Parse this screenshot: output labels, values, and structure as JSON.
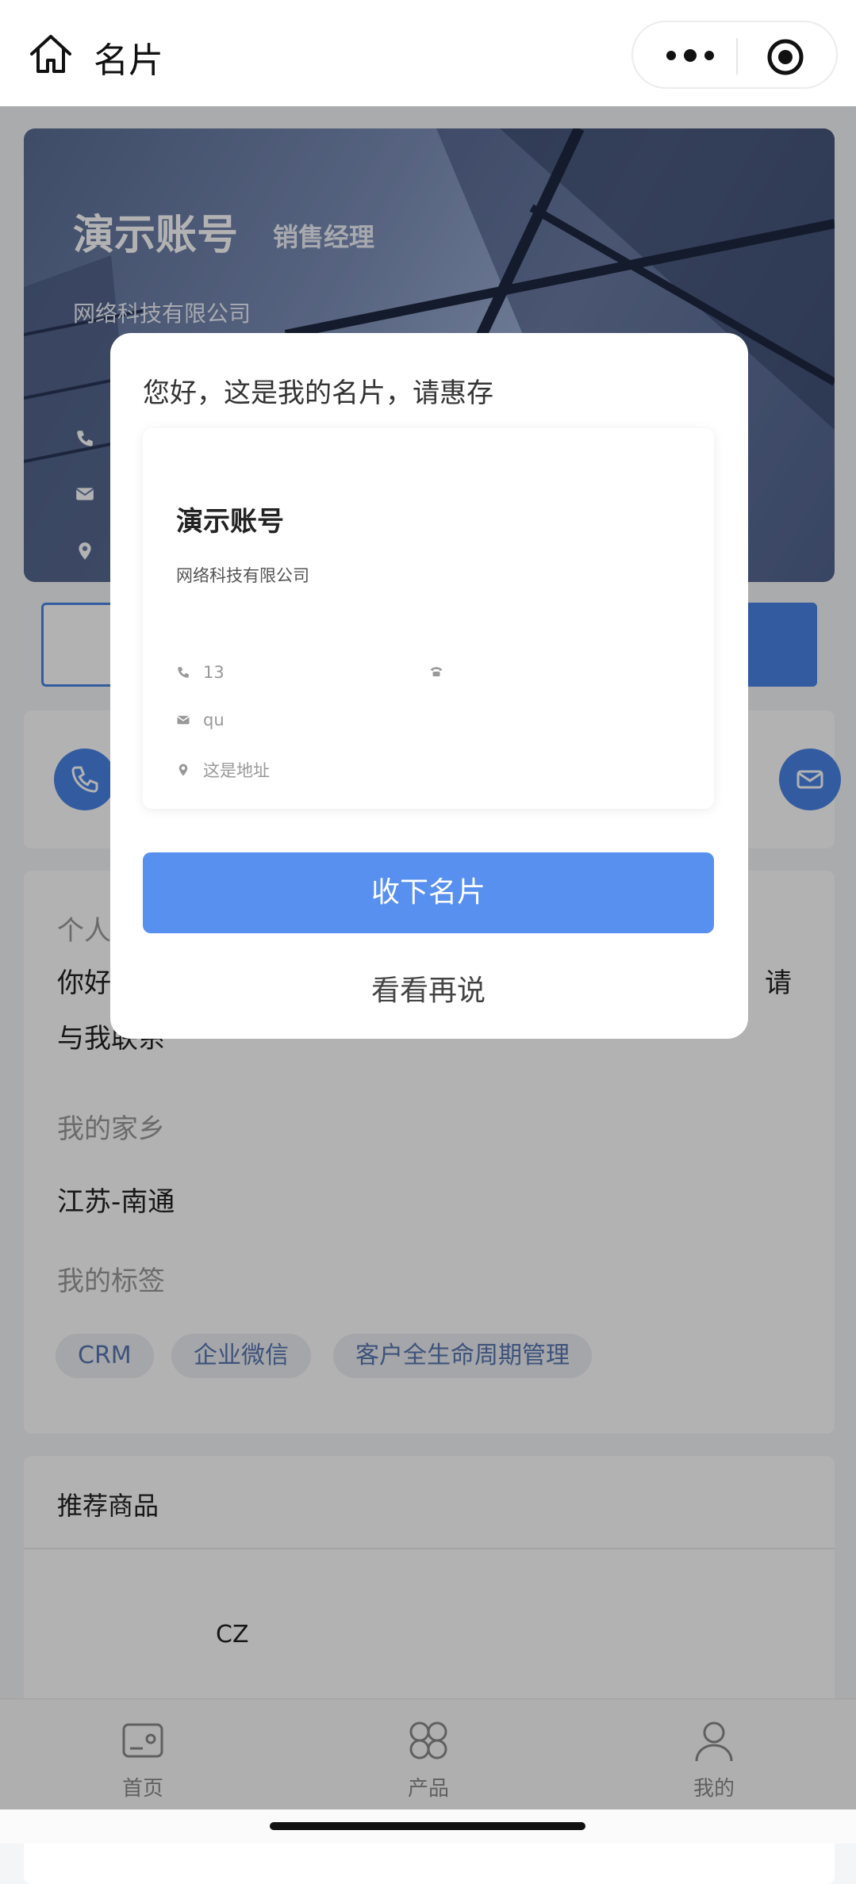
{
  "nav": {
    "title": "名片"
  },
  "hero": {
    "name": "演示账号",
    "title": "销售经理",
    "company": "网络科技有限公司"
  },
  "profile": {
    "intro_label": "个人",
    "intro_text_start": "你好",
    "intro_text_end": "请",
    "intro_text_line2": "与我联系",
    "hometown_label": "我的家乡",
    "hometown": "江苏-南通",
    "tags_label": "我的标签",
    "tags": [
      "CRM",
      "企业微信",
      "客户全生命周期管理"
    ]
  },
  "products": {
    "title": "推荐商品",
    "item_name": "CZ"
  },
  "tabbar": {
    "items": [
      {
        "label": "首页",
        "icon": "home-card-icon"
      },
      {
        "label": "产品",
        "icon": "grid-icon"
      },
      {
        "label": "我的",
        "icon": "user-icon"
      }
    ]
  },
  "modal": {
    "greeting": "您好，这是我的名片，请惠存",
    "card": {
      "name": "演示账号",
      "company": "网络科技有限公司",
      "phone": "13",
      "email": "qu",
      "address": "这是地址"
    },
    "accept_label": "收下名片",
    "later_label": "看看再说"
  },
  "colors": {
    "accent": "#4a84e6",
    "accept_button": "#5790ef",
    "tag_text": "#5877b0"
  }
}
